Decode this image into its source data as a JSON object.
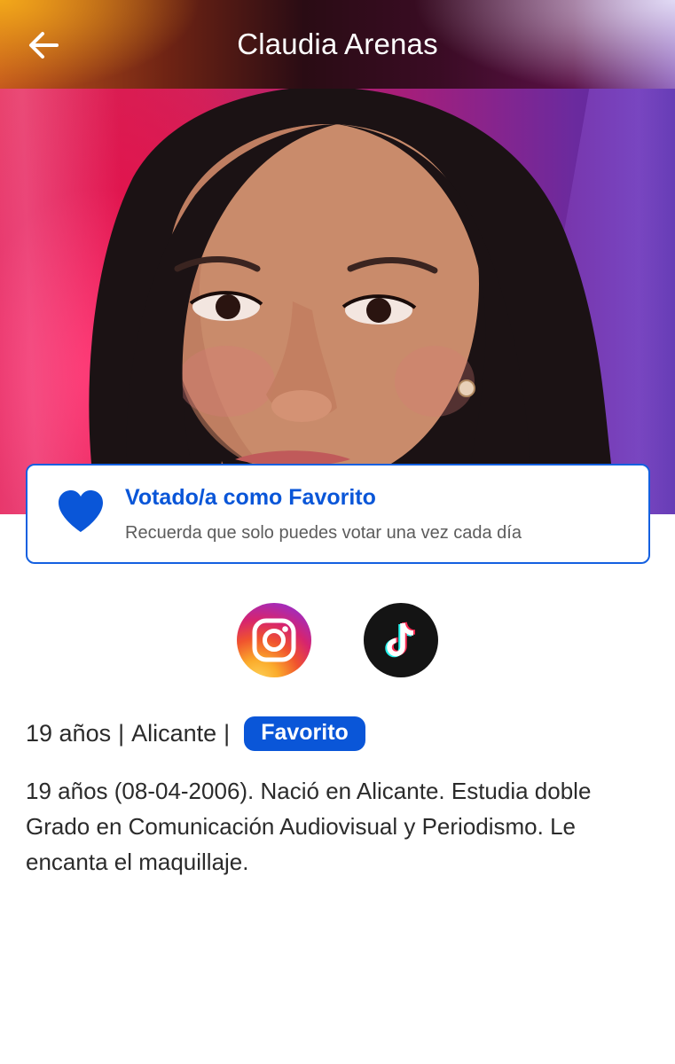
{
  "header": {
    "title": "Claudia Arenas",
    "back_icon": "arrow-left-icon"
  },
  "hero": {
    "photo_alt": "Claudia Arenas"
  },
  "vote_card": {
    "icon": "heart-icon",
    "title": "Votado/a como Favorito",
    "subtitle": "Recuerda que solo puedes votar una vez cada día",
    "accent_color": "#0a56d8"
  },
  "social": [
    {
      "name": "instagram",
      "icon": "instagram-icon"
    },
    {
      "name": "tiktok",
      "icon": "tiktok-icon"
    }
  ],
  "profile": {
    "age": "19 años",
    "separator": "|",
    "city": "Alicante",
    "badge": "Favorito",
    "bio": "19 años (08-04-2006). Nació en Alicante. Estudia doble Grado en Comunicación Audiovisual y Periodismo. Le encanta el maquillaje."
  }
}
